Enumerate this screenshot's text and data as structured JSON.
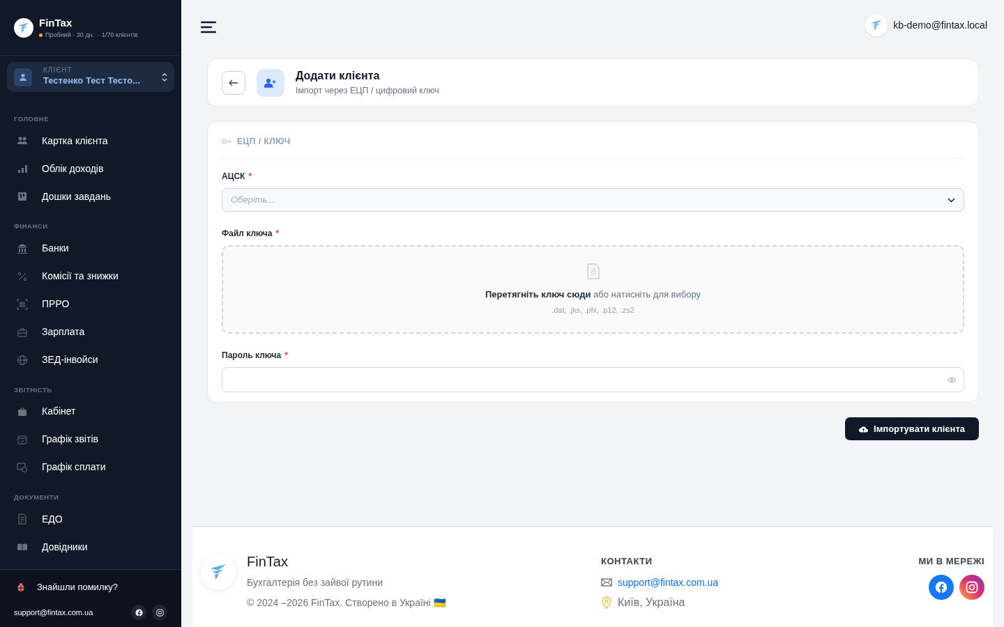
{
  "sidebar": {
    "brand": {
      "name": "FinTax",
      "plan": "Пробний - 30 дн.",
      "separator": "·",
      "clients": "1/70 клієнтів"
    },
    "client": {
      "label": "КЛІЄНТ",
      "name": "Тестенко Тест Тесто..."
    },
    "sections": [
      {
        "title": "ГОЛОВНЕ",
        "items": [
          {
            "label": "Картка клієнта"
          },
          {
            "label": "Облік доходів"
          },
          {
            "label": "Дошки завдань"
          }
        ]
      },
      {
        "title": "ФІНАНСИ",
        "items": [
          {
            "label": "Банки"
          },
          {
            "label": "Комісії та знижки"
          },
          {
            "label": "ПРРО"
          },
          {
            "label": "Зарплата"
          },
          {
            "label": "ЗЕД-інвойси"
          }
        ]
      },
      {
        "title": "ЗВІТНІСТЬ",
        "items": [
          {
            "label": "Кабінет"
          },
          {
            "label": "Графік звітів"
          },
          {
            "label": "Графік сплати"
          }
        ]
      },
      {
        "title": "ДОКУМЕНТИ",
        "items": [
          {
            "label": "ЕДО"
          },
          {
            "label": "Довідники"
          }
        ]
      }
    ],
    "bug_report": "Знайшли помилку?",
    "support_email": "support@fintax.com.ua"
  },
  "topbar": {
    "user": "kb-demo@fintax.local"
  },
  "header": {
    "title": "Додати клієнта",
    "subtitle": "Імпорт через ЕЦП / цифровий ключ"
  },
  "form": {
    "section": "ЕЦП / КЛЮЧ",
    "acsk": {
      "label": "АЦСК",
      "required_mark": "*",
      "placeholder": "Оберіть..."
    },
    "key_file": {
      "label": "Файл ключа",
      "required_mark": "*",
      "drop_text": "**Перетягніть ключ сюди** або натисніть для вибору",
      "formats": ".dat, .jks, .pfx, .p12, .zs2"
    },
    "password": {
      "label": "Пароль ключа",
      "required_mark": "*"
    },
    "submit": "Імпортувати клієнта"
  },
  "footer": {
    "brand": "FinTax",
    "tagline": "Бухгалтерія без зайвої рутини",
    "copyright": "© 2024 –2026 FinTax. Створено в Україні 🇺🇦",
    "contacts_title": "КОНТАКТИ",
    "email": "support@fintax.com.ua",
    "location": "Київ, Україна",
    "social_title": "МИ В МЕРЕЖІ"
  }
}
